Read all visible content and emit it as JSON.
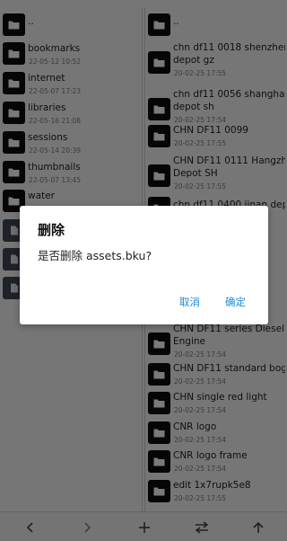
{
  "left_pane": {
    "items": [
      {
        "name": "..",
        "date": "",
        "type": "folder"
      },
      {
        "name": "bookmarks",
        "date": "22-05-12 10:52",
        "type": "folder"
      },
      {
        "name": "internet",
        "date": "22-05-07 17:23",
        "type": "folder"
      },
      {
        "name": "libraries",
        "date": "22-05-16 21:08",
        "type": "folder"
      },
      {
        "name": "sessions",
        "date": "22-05-14 20:39",
        "type": "folder"
      },
      {
        "name": "thumbnails",
        "date": "22-05-07 13:45",
        "type": "folder"
      },
      {
        "name": "water",
        "date": "22-05-07 19:02",
        "type": "folder"
      },
      {
        "name": "",
        "date": "",
        "type": "file"
      },
      {
        "name": "",
        "date": "",
        "type": "file"
      },
      {
        "name": "",
        "date": "",
        "type": "file"
      }
    ]
  },
  "right_pane": {
    "items": [
      {
        "name": "..",
        "name2": "",
        "date": ""
      },
      {
        "name": "chn df11 0018 shenzhen",
        "name2": "depot gz",
        "date": "20-02-25 17:55"
      },
      {
        "name": "chn df11 0056 shanghai",
        "name2": "depot sh",
        "date": "20-02-25 17:54"
      },
      {
        "name": "CHN DF11 0099",
        "name2": "",
        "date": "20-02-25 17:55"
      },
      {
        "name": "CHN DF11 0111 Hangzhou",
        "name2": "Depot SH",
        "date": "20-02-25 17:55"
      },
      {
        "name": "chn df11 0400 jinan depot",
        "name2": "",
        "date": ""
      },
      {
        "name": "CHN DF11 series Diesel",
        "name2": "Engine",
        "date": "20-02-25 17:54"
      },
      {
        "name": "CHN DF11 standard bogey",
        "name2": "",
        "date": "20-02-25 17:54"
      },
      {
        "name": "CHN single red light",
        "name2": "",
        "date": "20-02-25 17:54"
      },
      {
        "name": "CNR logo",
        "name2": "",
        "date": "20-02-25 17:54"
      },
      {
        "name": "CNR logo frame",
        "name2": "",
        "date": "20-02-25 17:54"
      },
      {
        "name": "edit 1x7rupk5e8",
        "name2": "",
        "date": "20-02-25 17:55"
      }
    ]
  },
  "toolbar": {
    "icons": [
      "back-icon",
      "forward-icon",
      "add-icon",
      "swap-icon",
      "up-icon"
    ]
  },
  "dialog": {
    "title": "删除",
    "message": "是否删除 assets.bku?",
    "cancel_label": "取消",
    "confirm_label": "确定",
    "accent_color": "#1c8ad8"
  }
}
